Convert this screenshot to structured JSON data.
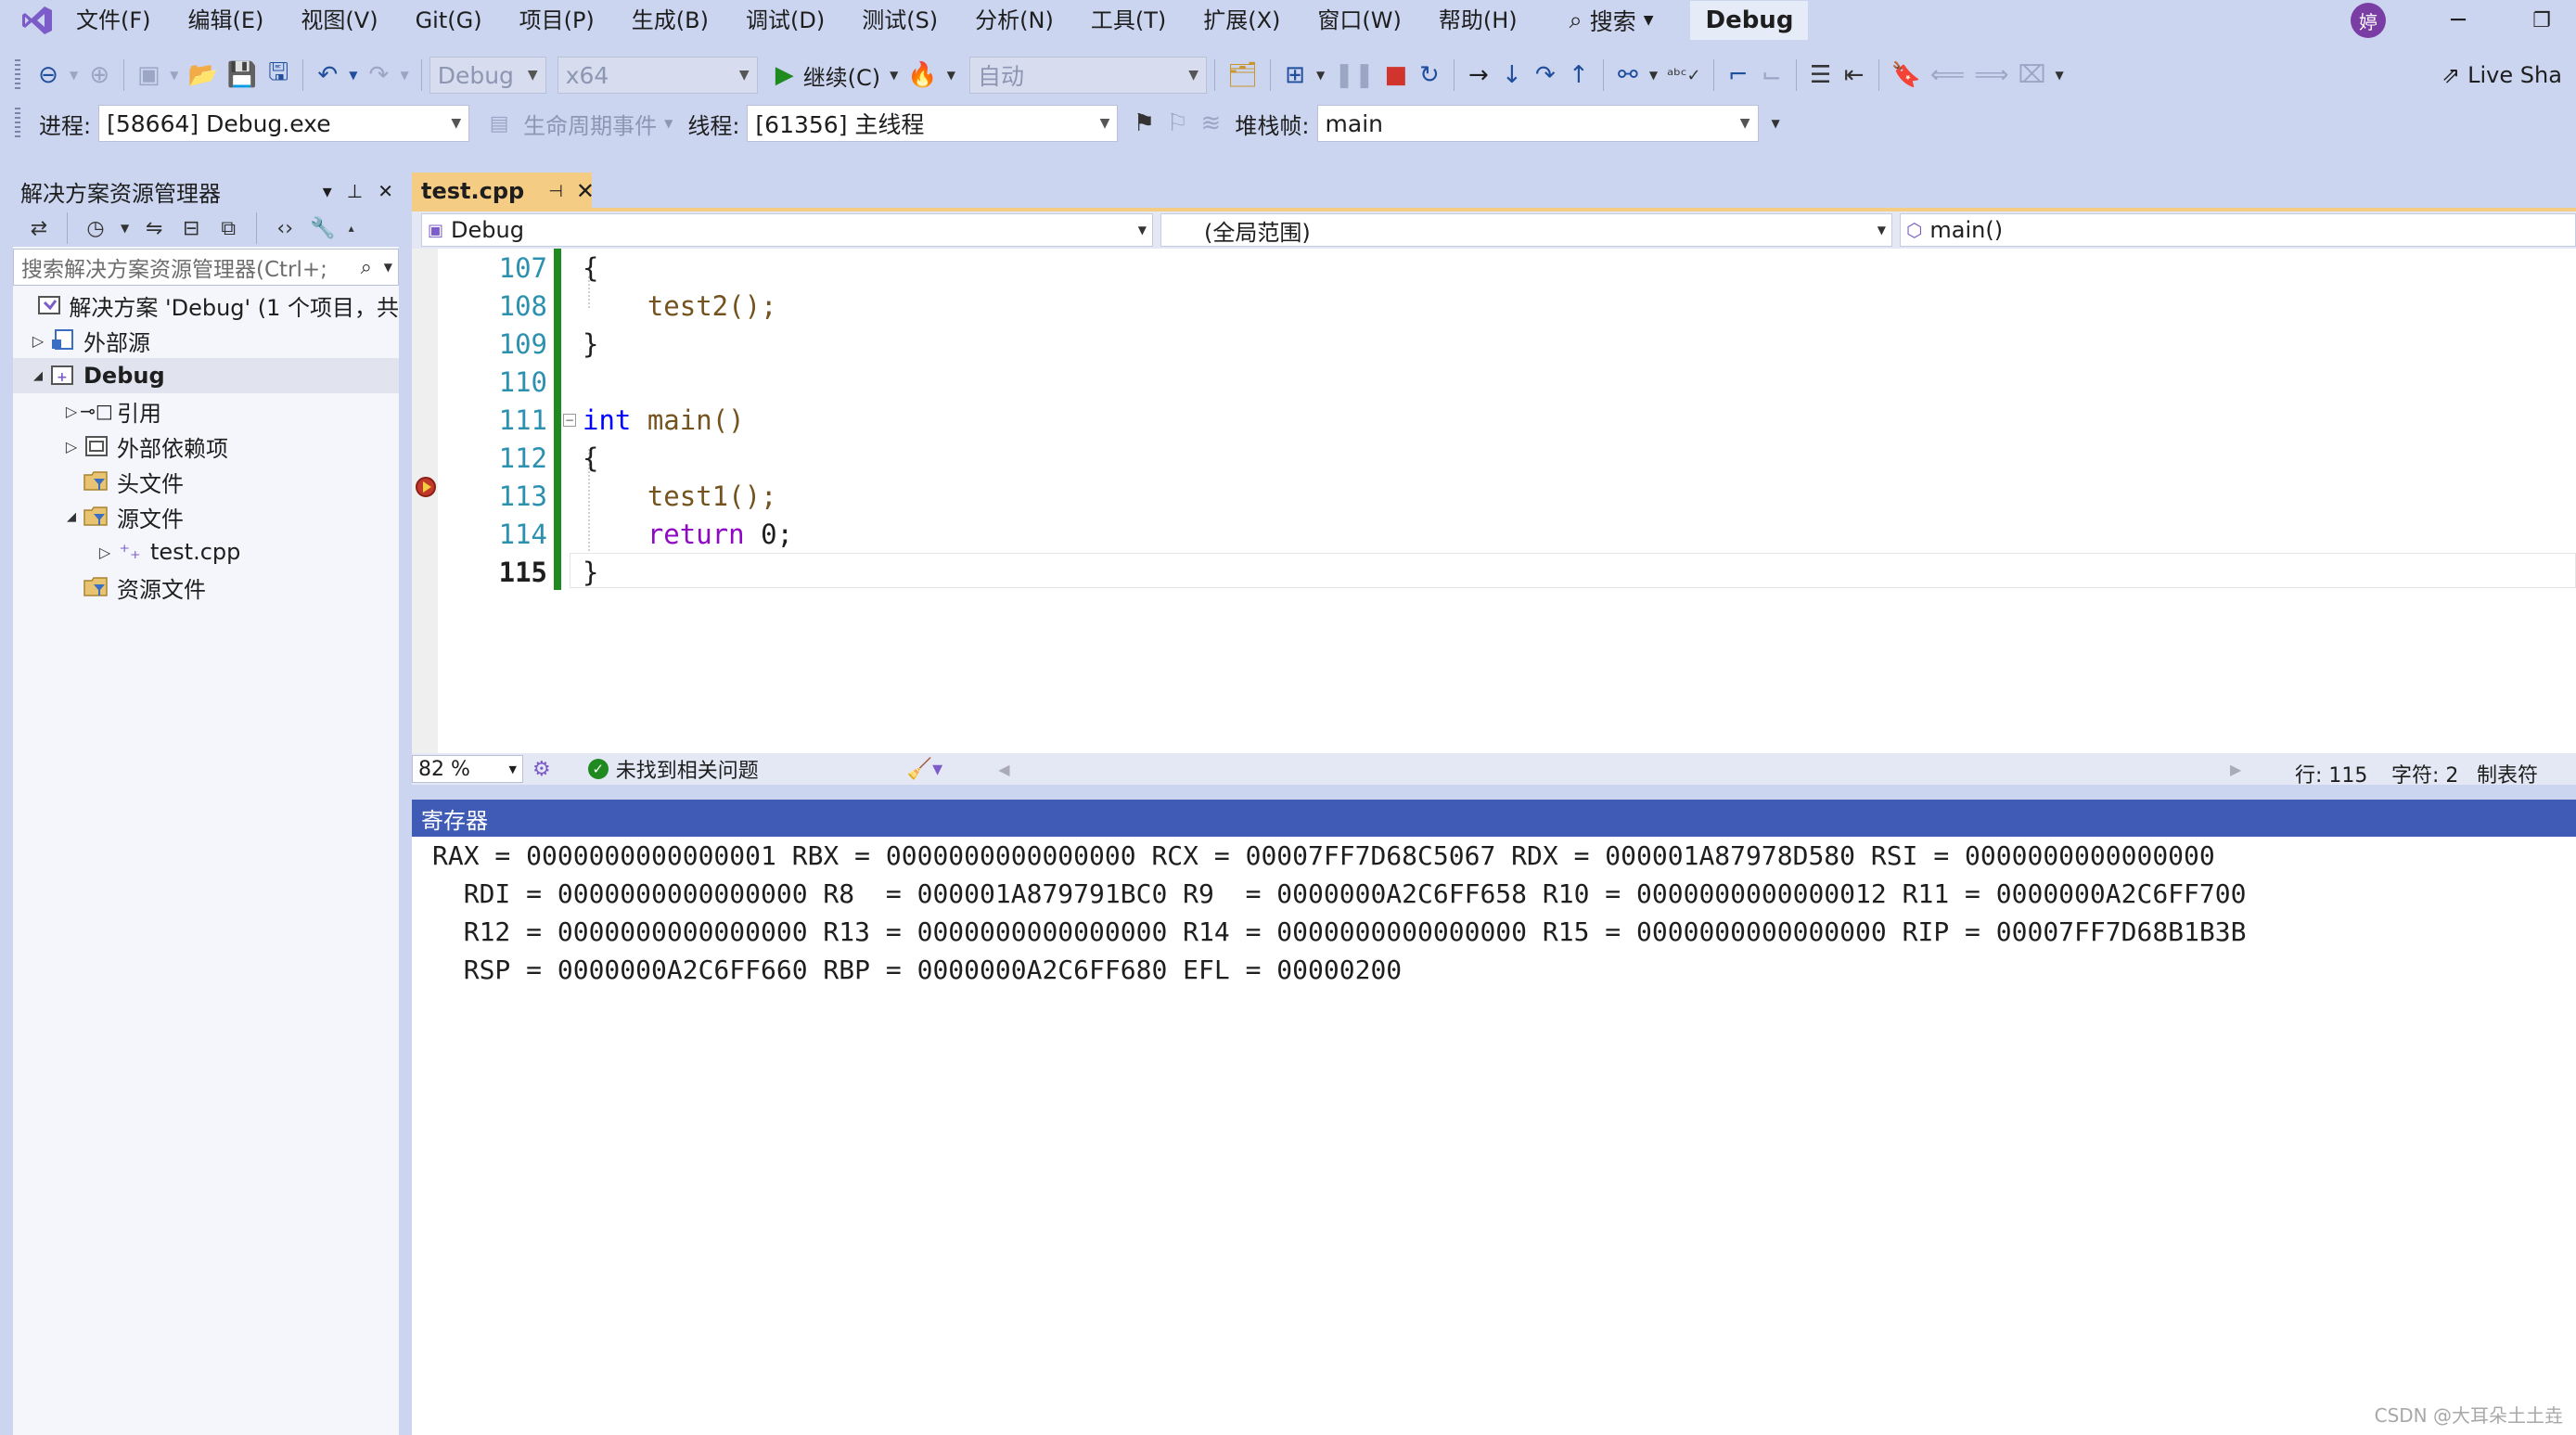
{
  "menu": {
    "items": [
      "文件(F)",
      "编辑(E)",
      "视图(V)",
      "Git(G)",
      "项目(P)",
      "生成(B)",
      "调试(D)",
      "测试(S)",
      "分析(N)",
      "工具(T)",
      "扩展(X)",
      "窗口(W)",
      "帮助(H)"
    ],
    "search_label": "搜索",
    "solution_name": "Debug",
    "avatar_text": "婷"
  },
  "toolbar1": {
    "config": "Debug",
    "platform": "x64",
    "continue_label": "继续(C)",
    "auto_label": "自动",
    "live_share": "Live Sha"
  },
  "toolbar2": {
    "process_label": "进程:",
    "process_value": "[58664] Debug.exe",
    "lifecycle_label": "生命周期事件",
    "thread_label": "线程:",
    "thread_value": "[61356] 主线程",
    "stackframe_label": "堆栈帧:",
    "stackframe_value": "main"
  },
  "solution_explorer": {
    "title": "解决方案资源管理器",
    "search_placeholder": "搜索解决方案资源管理器(Ctrl+;",
    "tree": [
      {
        "label": "解决方案 'Debug' (1 个项目，共",
        "level": 0,
        "expander": ""
      },
      {
        "label": "外部源",
        "level": 0,
        "expander": "▷"
      },
      {
        "label": "Debug",
        "level": 0,
        "expander": "◢",
        "bold": true
      },
      {
        "label": "引用",
        "level": 1,
        "expander": "▷"
      },
      {
        "label": "外部依赖项",
        "level": 1,
        "expander": "▷"
      },
      {
        "label": "头文件",
        "level": 1,
        "expander": ""
      },
      {
        "label": "源文件",
        "level": 1,
        "expander": "◢"
      },
      {
        "label": "test.cpp",
        "level": 2,
        "expander": "▷"
      },
      {
        "label": "资源文件",
        "level": 1,
        "expander": ""
      }
    ]
  },
  "editor": {
    "tab_label": "test.cpp",
    "nav_project": "Debug",
    "nav_scope": "(全局范围)",
    "nav_member": "main()",
    "lines": [
      {
        "num": "107",
        "text": "{"
      },
      {
        "num": "108",
        "text": "    test2();"
      },
      {
        "num": "109",
        "text": "}"
      },
      {
        "num": "110",
        "text": ""
      },
      {
        "num": "111",
        "text": "int main()"
      },
      {
        "num": "112",
        "text": "{"
      },
      {
        "num": "113",
        "text": "    test1();"
      },
      {
        "num": "114",
        "text": "    return 0;"
      },
      {
        "num": "115",
        "text": "}"
      }
    ]
  },
  "status": {
    "zoom": "82 %",
    "issues": "未找到相关问题",
    "line": "行: 115",
    "char": "字符: 2",
    "tab": "制表符"
  },
  "registers": {
    "title": "寄存器",
    "lines": [
      "RAX = 0000000000000001 RBX = 0000000000000000 RCX = 00007FF7D68C5067 RDX = 000001A87978D580 RSI = 0000000000000000",
      "  RDI = 0000000000000000 R8  = 000001A879791BC0 R9  = 0000000A2C6FF658 R10 = 0000000000000012 R11 = 0000000A2C6FF700",
      "  R12 = 0000000000000000 R13 = 0000000000000000 R14 = 0000000000000000 R15 = 0000000000000000 RIP = 00007FF7D68B1B3B",
      "  RSP = 0000000A2C6FF660 RBP = 0000000A2C6FF680 EFL = 00000200"
    ]
  },
  "watermark": "CSDN @大耳朵土土垚",
  "colors": {
    "accent": "#3f5bb6",
    "tab_active": "#f5cc84",
    "chrome": "#ccd5f0",
    "keyword": "#0000ff"
  }
}
